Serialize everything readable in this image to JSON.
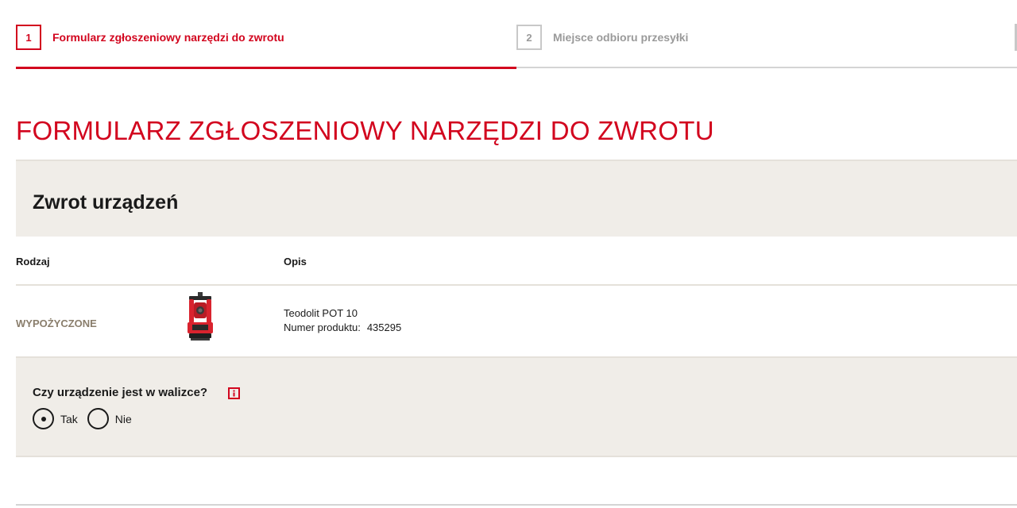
{
  "steps": [
    {
      "number": "1",
      "label": "Formularz zgłoszeniowy narzędzi do zwrotu",
      "state": "active"
    },
    {
      "number": "2",
      "label": "Miejsce odbioru przesyłki",
      "state": "inactive"
    }
  ],
  "progress": {
    "completed_fraction": 0.5
  },
  "page_title": "FORMULARZ ZGŁOSZENIOWY NARZĘDZI DO ZWROTU",
  "section": {
    "title": "Zwrot urządzeń"
  },
  "table": {
    "headers": {
      "type": "Rodzaj",
      "description": "Opis"
    },
    "rows": [
      {
        "type": "WYPOŻYCZONE",
        "image_icon": "theodolite-product-image",
        "name": "Teodolit POT 10",
        "number_label": "Numer produktu:",
        "number_value": "435295"
      }
    ]
  },
  "question": {
    "text": "Czy urządzenie jest w walizce?",
    "info_icon": "info-icon",
    "options": [
      {
        "label": "Tak",
        "checked": true
      },
      {
        "label": "Nie",
        "checked": false
      }
    ]
  },
  "colors": {
    "accent": "#d2051e",
    "panel_background": "#f0ede8",
    "muted_text": "#9a9a9a",
    "type_text": "#8a7e6c"
  }
}
